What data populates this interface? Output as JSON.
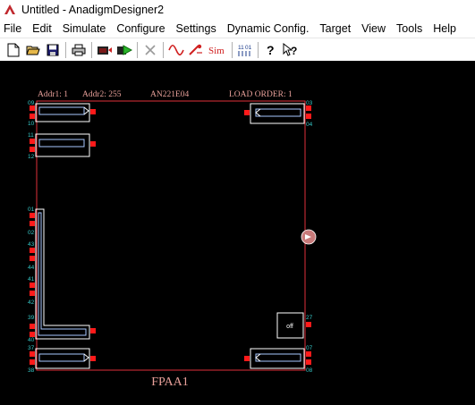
{
  "window": {
    "title": "Untitled - AnadigmDesigner2"
  },
  "menu": [
    "File",
    "Edit",
    "Simulate",
    "Configure",
    "Settings",
    "Dynamic Config.",
    "Target",
    "View",
    "Tools",
    "Help"
  ],
  "toolbar": {
    "icons": [
      "new-icon",
      "open-icon",
      "save-icon",
      "print-icon",
      "configure-icon",
      "simulate-run-icon",
      "delete-icon",
      "signal-generator-icon",
      "probe-icon",
      "sim-icon",
      "bitstream-icon",
      "help-icon",
      "context-help-icon"
    ],
    "sim_label": "Sim",
    "bitstream_label": "11\n01"
  },
  "chip": {
    "addr1": "Addr1: 1",
    "addr2": "Addr2: 255",
    "part": "AN221E04",
    "load_order": "LOAD ORDER: 1",
    "name": "FPAA1",
    "off_label": "off",
    "pins": {
      "p09": "09",
      "p10": "10",
      "p11": "11",
      "p12": "12",
      "p01": "01",
      "p02": "02",
      "p43": "43",
      "p44": "44",
      "p41": "41",
      "p42": "42",
      "p39": "39",
      "p40": "40",
      "p37": "37",
      "p38": "38",
      "p03": "03",
      "p04": "04",
      "p27": "27",
      "p07": "07",
      "p08": "08"
    }
  },
  "colors": {
    "chip_border": "#e0303a",
    "pad": "#ff1a1a",
    "label": "#e8a09a",
    "pin_number": "#36c8c8",
    "canvas": "#000000"
  }
}
